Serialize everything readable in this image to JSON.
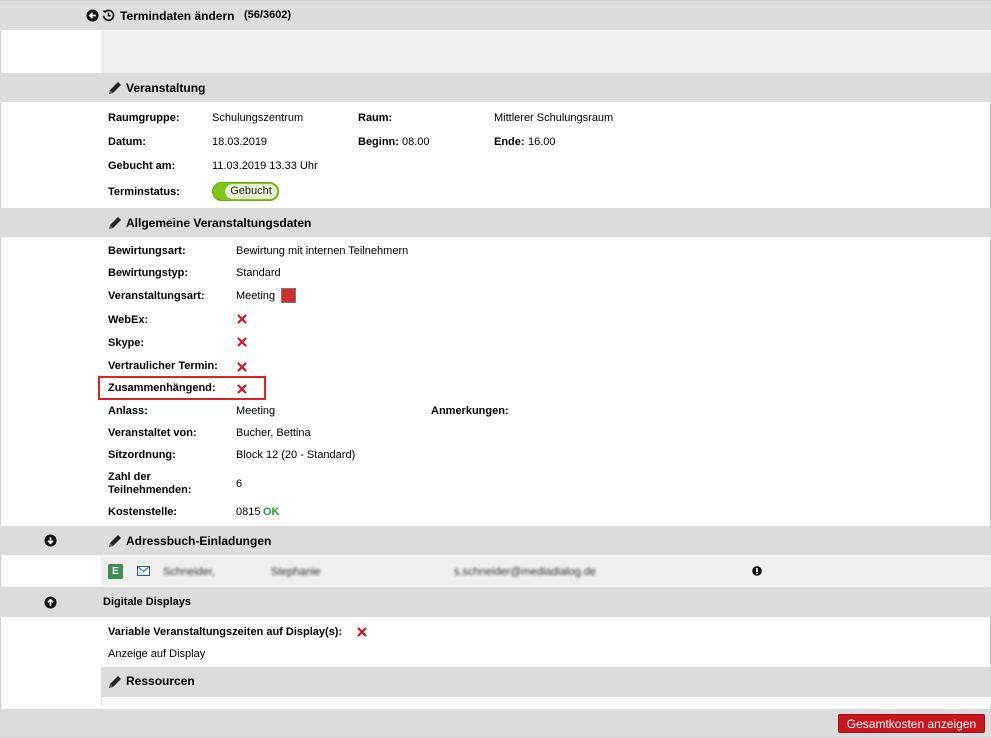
{
  "header": {
    "title": "Termindaten ändern",
    "counter": "(56/3602)"
  },
  "sections": {
    "veranstaltung": {
      "title": "Veranstaltung",
      "raumgruppe_label": "Raumgruppe:",
      "raumgruppe_value": "Schulungszentrum",
      "raum_label": "Raum:",
      "raum_value": "Mittlerer Schulungsraum",
      "datum_label": "Datum:",
      "datum_value": "18.03.2019",
      "beginn_label": "Beginn:",
      "beginn_value": "08.00",
      "ende_label": "Ende:",
      "ende_value": "16.00",
      "gebucht_label": "Gebucht am:",
      "gebucht_value": "11.03.2019 13.33 Uhr",
      "status_label": "Terminstatus:",
      "status_value": "Gebucht"
    },
    "allgemein": {
      "title": "Allgemeine Veranstaltungsdaten",
      "bewirtungsart_label": "Bewirtungsart:",
      "bewirtungsart_value": "Bewirtung mit internen Teilnehmern",
      "bewirtungstyp_label": "Bewirtungstyp:",
      "bewirtungstyp_value": "Standard",
      "veranstaltungsart_label": "Veranstaltungsart:",
      "veranstaltungsart_value": "Meeting",
      "veranstaltungsart_color": "#d32d2d",
      "webex_label": "WebEx:",
      "skype_label": "Skype:",
      "vertraulich_label": "Vertraulicher Termin:",
      "zusammen_label": "Zusammenhängend:",
      "anlass_label": "Anlass:",
      "anlass_value": "Meeting",
      "anmerkungen_label": "Anmerkungen:",
      "veranstaltet_label": "Veranstaltet von:",
      "veranstaltet_value": "Bucher, Bettina",
      "sitz_label": "Sitzordnung:",
      "sitz_value": "Block 12 (20 - Standard)",
      "zahl_label_1": "Zahl der",
      "zahl_label_2": "Teilnehmenden:",
      "zahl_value": "6",
      "kosten_label": "Kostenstelle:",
      "kosten_value": "0815",
      "kosten_status": "OK"
    },
    "adressbuch": {
      "title": "Adressbuch-Einladungen",
      "badge": "E",
      "lastname": "Schneider,",
      "firstname": "Stephanie",
      "email": "s.schneider@mediadialog.de"
    },
    "displays": {
      "title": "Digitale Displays",
      "variable_label": "Variable Veranstaltungszeiten auf Display(s):",
      "anzeige_text": "Anzeige auf Display"
    },
    "ressourcen": {
      "title": "Ressourcen"
    }
  },
  "footer": {
    "costs_button": "Gesamtkosten anzeigen"
  },
  "colors": {
    "accent_red": "#c8161e",
    "status_green": "#7ec41a",
    "x_red": "#d0152a"
  }
}
